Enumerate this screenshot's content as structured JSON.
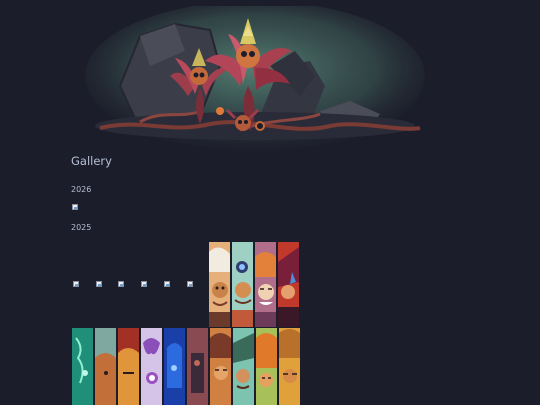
{
  "gallery": {
    "title": "Gallery",
    "years": [
      "2026",
      "2025"
    ]
  },
  "images": {
    "banner": "plant-creatures-among-rocks-artwork",
    "broken_icon": "broken-image-icon"
  },
  "colors": {
    "background": "#1c1d2a",
    "text": "#b6bfd4"
  }
}
